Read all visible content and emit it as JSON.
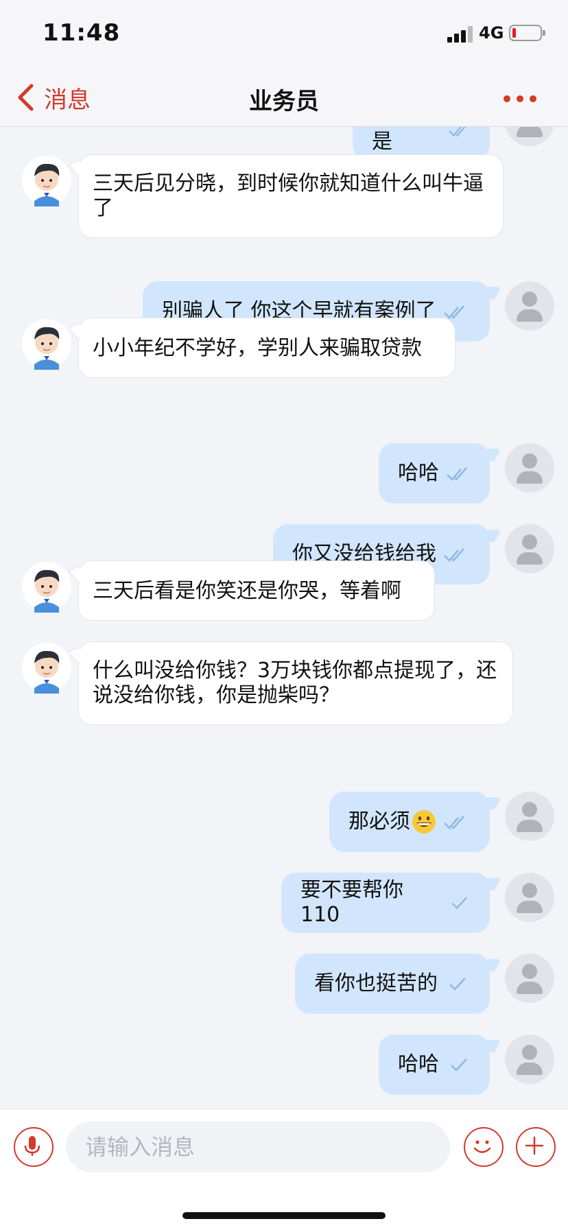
{
  "status_bar": {
    "time": "11:48",
    "network": "4G",
    "battery_level": 0.1
  },
  "nav": {
    "back_label": "消息",
    "title": "业务员",
    "more_icon": "more-dots-icon"
  },
  "colors": {
    "accent": "#d23a2a",
    "outgoing_bubble": "#d1e6fc",
    "incoming_bubble": "#ffffff",
    "background": "#f3f4f8",
    "check": "#8fb7e4"
  },
  "messages": [
    {
      "from": "self",
      "text": "嗯 平 是",
      "status": "read"
    },
    {
      "from": "agent",
      "text": "三天后见分晓，到时候你就知道什么叫牛逼了"
    },
    {
      "from": "self",
      "text": "别骗人了 你这个早就有案例了",
      "status": "read"
    },
    {
      "from": "agent",
      "text": "小小年纪不学好，学别人来骗取贷款"
    },
    {
      "from": "self",
      "text": "哈哈",
      "status": "read"
    },
    {
      "from": "self",
      "text": "你又没给钱给我",
      "status": "read"
    },
    {
      "from": "agent",
      "text": "三天后看是你笑还是你哭，等着啊"
    },
    {
      "from": "agent",
      "text": "什么叫没给你钱？3万块钱你都点提现了，还说没给你钱，你是抛柴吗？"
    },
    {
      "from": "self",
      "text": "那必须",
      "emoji": "grinning-face",
      "status": "read"
    },
    {
      "from": "self",
      "text": "要不要帮你 110",
      "status": "sent"
    },
    {
      "from": "self",
      "text": "看你也挺苦的",
      "status": "sent"
    },
    {
      "from": "self",
      "text": "哈哈",
      "status": "sent"
    }
  ],
  "input_bar": {
    "placeholder": "请输入消息",
    "voice_icon": "microphone-icon",
    "emoji_icon": "smiley-icon",
    "plus_icon": "plus-icon"
  }
}
